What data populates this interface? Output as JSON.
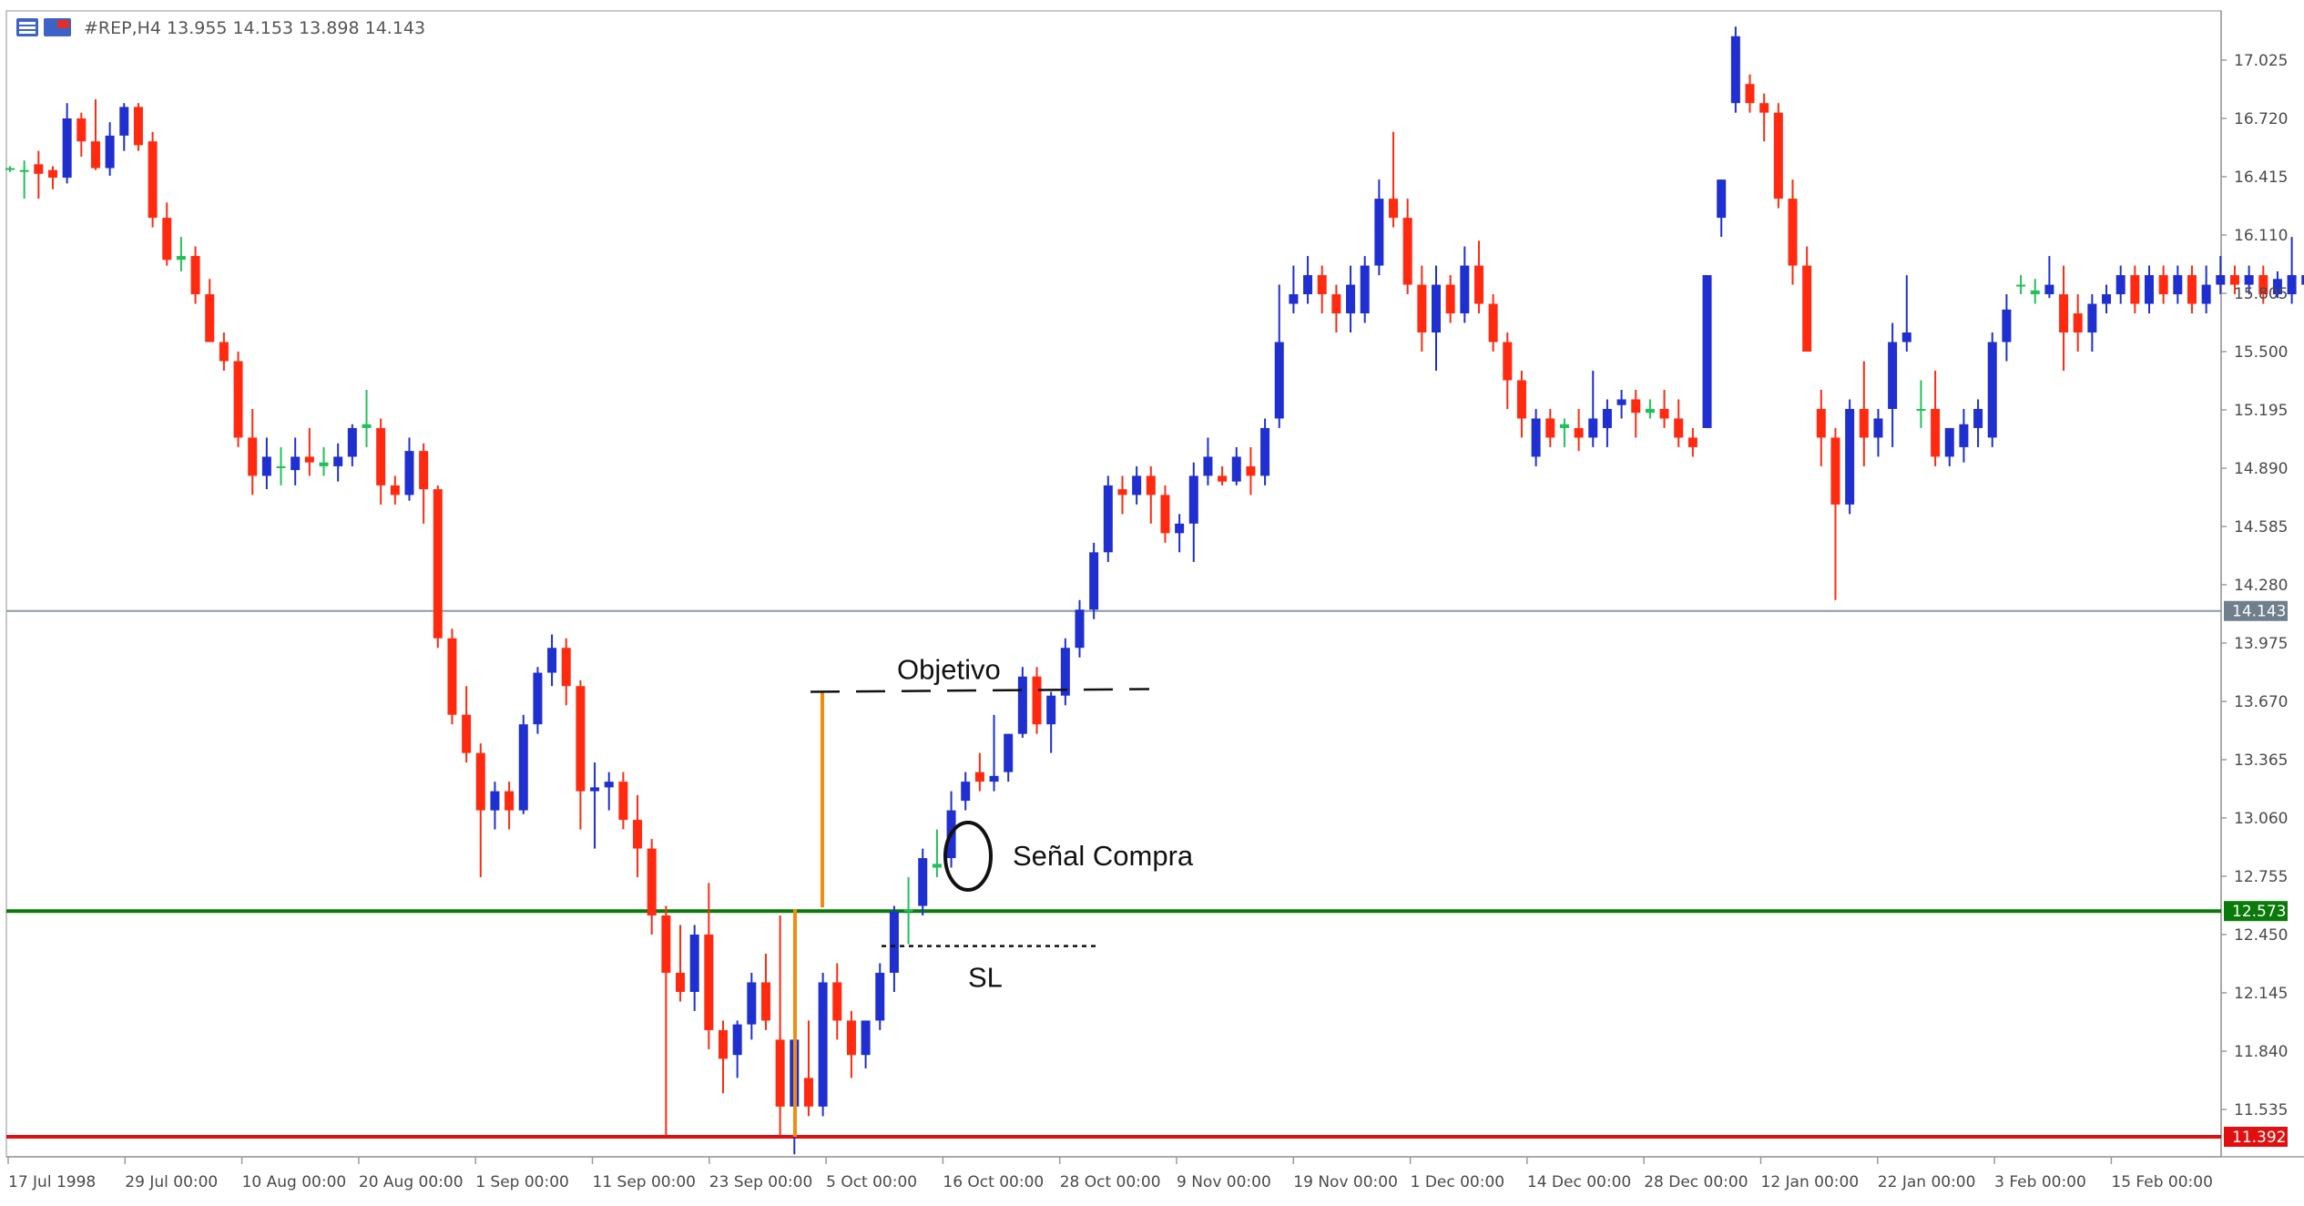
{
  "header": {
    "symbol_line": "#REP,H4  13.955  14.153  13.898  14.143",
    "icons": [
      "menu-icon",
      "window-icon"
    ]
  },
  "colors": {
    "bull": "#1f2fd0",
    "bear": "#ff2a10",
    "doji": "#22c05a",
    "entry_line": "#0a7a0a",
    "stop_line": "#e01010",
    "price_line": "#8a9aa6",
    "target_line": "#f08c10"
  },
  "chart_data": {
    "type": "candlestick",
    "ylim": [
      11.2,
      17.3
    ],
    "y_ticks": [
      "17.025",
      "16.720",
      "16.415",
      "16.110",
      "15.805",
      "15.500",
      "15.195",
      "14.890",
      "14.585",
      "14.280",
      "13.975",
      "13.670",
      "13.365",
      "13.060",
      "12.755",
      "12.450",
      "12.145",
      "11.840",
      "11.535"
    ],
    "x_ticks": [
      "17 Jul 1998",
      "29 Jul 00:00",
      "10 Aug 00:00",
      "20 Aug 00:00",
      "1 Sep 00:00",
      "11 Sep 00:00",
      "23 Sep 00:00",
      "5 Oct 00:00",
      "16 Oct 00:00",
      "28 Oct 00:00",
      "9 Nov 00:00",
      "19 Nov 00:00",
      "1 Dec 00:00",
      "14 Dec 00:00",
      "28 Dec 00:00",
      "12 Jan 00:00",
      "22 Jan 00:00",
      "3 Feb 00:00",
      "15 Feb 00:00"
    ],
    "current_price": "14.143",
    "horizontal_lines": [
      {
        "label": "14.143",
        "value": 14.143,
        "role": "current-price"
      },
      {
        "label": "12.573",
        "value": 12.573,
        "role": "entry"
      },
      {
        "label": "11.392",
        "value": 11.392,
        "role": "stop-low"
      }
    ],
    "annotations": {
      "objetivo": "Objetivo",
      "senal": "Señal Compra",
      "sl": "SL"
    },
    "target_level": 13.72,
    "sl_level": 12.39,
    "candles": [
      [
        16.45,
        16.47,
        16.44,
        16.46
      ],
      [
        16.44,
        16.5,
        16.3,
        16.45
      ],
      [
        16.48,
        16.55,
        16.3,
        16.43
      ],
      [
        16.45,
        16.47,
        16.35,
        16.41
      ],
      [
        16.41,
        16.8,
        16.38,
        16.72
      ],
      [
        16.72,
        16.75,
        16.52,
        16.6
      ],
      [
        16.6,
        16.82,
        16.45,
        16.46
      ],
      [
        16.46,
        16.7,
        16.42,
        16.63
      ],
      [
        16.63,
        16.8,
        16.55,
        16.78
      ],
      [
        16.78,
        16.8,
        16.55,
        16.58
      ],
      [
        16.6,
        16.65,
        16.15,
        16.2
      ],
      [
        16.2,
        16.28,
        15.95,
        15.98
      ],
      [
        15.98,
        16.1,
        15.92,
        16.0
      ],
      [
        16.0,
        16.05,
        15.75,
        15.8
      ],
      [
        15.8,
        15.88,
        15.55,
        15.55
      ],
      [
        15.55,
        15.6,
        15.4,
        15.45
      ],
      [
        15.45,
        15.5,
        15.0,
        15.05
      ],
      [
        15.05,
        15.2,
        14.75,
        14.85
      ],
      [
        14.85,
        15.05,
        14.78,
        14.95
      ],
      [
        14.9,
        15.0,
        14.8,
        14.9
      ],
      [
        14.88,
        15.05,
        14.8,
        14.95
      ],
      [
        14.95,
        15.1,
        14.85,
        14.92
      ],
      [
        14.92,
        15.0,
        14.85,
        14.9
      ],
      [
        14.9,
        15.02,
        14.82,
        14.95
      ],
      [
        14.95,
        15.12,
        14.9,
        15.1
      ],
      [
        15.1,
        15.3,
        15.0,
        15.12
      ],
      [
        15.1,
        15.15,
        14.7,
        14.8
      ],
      [
        14.8,
        14.85,
        14.7,
        14.75
      ],
      [
        14.75,
        15.05,
        14.72,
        14.98
      ],
      [
        14.98,
        15.02,
        14.6,
        14.78
      ],
      [
        14.78,
        14.8,
        13.95,
        14.0
      ],
      [
        14.0,
        14.05,
        13.55,
        13.6
      ],
      [
        13.6,
        13.75,
        13.35,
        13.4
      ],
      [
        13.4,
        13.45,
        12.75,
        13.1
      ],
      [
        13.1,
        13.25,
        13.0,
        13.2
      ],
      [
        13.2,
        13.25,
        13.0,
        13.1
      ],
      [
        13.1,
        13.6,
        13.08,
        13.55
      ],
      [
        13.55,
        13.85,
        13.5,
        13.82
      ],
      [
        13.82,
        14.02,
        13.75,
        13.95
      ],
      [
        13.95,
        14.0,
        13.65,
        13.75
      ],
      [
        13.75,
        13.78,
        13.0,
        13.2
      ],
      [
        13.2,
        13.35,
        12.9,
        13.22
      ],
      [
        13.22,
        13.3,
        13.1,
        13.25
      ],
      [
        13.25,
        13.3,
        13.0,
        13.05
      ],
      [
        13.05,
        13.18,
        12.75,
        12.9
      ],
      [
        12.9,
        12.95,
        12.45,
        12.55
      ],
      [
        12.55,
        12.6,
        11.4,
        12.25
      ],
      [
        12.25,
        12.5,
        12.1,
        12.15
      ],
      [
        12.15,
        12.5,
        12.05,
        12.45
      ],
      [
        12.45,
        12.72,
        11.85,
        11.95
      ],
      [
        11.95,
        12.0,
        11.62,
        11.8
      ],
      [
        11.82,
        12.0,
        11.7,
        11.98
      ],
      [
        11.98,
        12.25,
        11.9,
        12.2
      ],
      [
        12.2,
        12.35,
        11.95,
        12.0
      ],
      [
        11.9,
        12.55,
        11.4,
        11.55
      ],
      [
        11.55,
        12.05,
        11.3,
        11.9
      ],
      [
        11.7,
        12.0,
        11.5,
        11.55
      ],
      [
        11.55,
        12.25,
        11.5,
        12.2
      ],
      [
        12.2,
        12.3,
        11.9,
        12.0
      ],
      [
        12.0,
        12.05,
        11.7,
        11.82
      ],
      [
        11.82,
        12.0,
        11.75,
        12.0
      ],
      [
        12.0,
        12.3,
        11.95,
        12.25
      ],
      [
        12.25,
        12.6,
        12.15,
        12.57
      ],
      [
        12.57,
        12.75,
        12.4,
        12.58
      ],
      [
        12.6,
        12.9,
        12.55,
        12.85
      ],
      [
        12.8,
        13.0,
        12.75,
        12.82
      ],
      [
        12.85,
        13.2,
        12.8,
        13.1
      ],
      [
        13.15,
        13.3,
        13.1,
        13.25
      ],
      [
        13.3,
        13.4,
        13.2,
        13.25
      ],
      [
        13.25,
        13.6,
        13.2,
        13.28
      ],
      [
        13.3,
        13.5,
        13.25,
        13.5
      ],
      [
        13.5,
        13.85,
        13.48,
        13.8
      ],
      [
        13.8,
        13.85,
        13.5,
        13.55
      ],
      [
        13.55,
        13.72,
        13.4,
        13.7
      ],
      [
        13.7,
        14.0,
        13.65,
        13.95
      ],
      [
        13.95,
        14.2,
        13.9,
        14.15
      ],
      [
        14.15,
        14.5,
        14.1,
        14.45
      ],
      [
        14.45,
        14.85,
        14.4,
        14.8
      ],
      [
        14.78,
        14.85,
        14.65,
        14.75
      ],
      [
        14.75,
        14.9,
        14.7,
        14.85
      ],
      [
        14.85,
        14.9,
        14.6,
        14.75
      ],
      [
        14.75,
        14.8,
        14.5,
        14.55
      ],
      [
        14.55,
        14.65,
        14.45,
        14.6
      ],
      [
        14.6,
        14.92,
        14.4,
        14.85
      ],
      [
        14.85,
        15.05,
        14.8,
        14.95
      ],
      [
        14.85,
        14.9,
        14.8,
        14.82
      ],
      [
        14.82,
        15.0,
        14.8,
        14.95
      ],
      [
        14.9,
        15.0,
        14.75,
        14.85
      ],
      [
        14.85,
        15.15,
        14.8,
        15.1
      ],
      [
        15.15,
        15.85,
        15.1,
        15.55
      ],
      [
        15.75,
        15.95,
        15.7,
        15.8
      ],
      [
        15.8,
        16.0,
        15.75,
        15.9
      ],
      [
        15.9,
        15.95,
        15.7,
        15.8
      ],
      [
        15.8,
        15.85,
        15.6,
        15.7
      ],
      [
        15.7,
        15.95,
        15.6,
        15.85
      ],
      [
        15.7,
        16.0,
        15.65,
        15.95
      ],
      [
        15.95,
        16.4,
        15.9,
        16.3
      ],
      [
        16.3,
        16.65,
        16.15,
        16.2
      ],
      [
        16.2,
        16.3,
        15.8,
        15.85
      ],
      [
        15.85,
        15.95,
        15.5,
        15.6
      ],
      [
        15.6,
        15.95,
        15.4,
        15.85
      ],
      [
        15.85,
        15.9,
        15.65,
        15.7
      ],
      [
        15.7,
        16.05,
        15.65,
        15.95
      ],
      [
        15.95,
        16.08,
        15.7,
        15.75
      ],
      [
        15.75,
        15.8,
        15.5,
        15.55
      ],
      [
        15.55,
        15.6,
        15.2,
        15.35
      ],
      [
        15.35,
        15.4,
        15.05,
        15.15
      ],
      [
        14.95,
        15.2,
        14.9,
        15.15
      ],
      [
        15.15,
        15.2,
        15.0,
        15.05
      ],
      [
        15.1,
        15.15,
        15.0,
        15.12
      ],
      [
        15.1,
        15.2,
        14.98,
        15.05
      ],
      [
        15.05,
        15.4,
        15.0,
        15.15
      ],
      [
        15.1,
        15.25,
        15.0,
        15.2
      ],
      [
        15.22,
        15.3,
        15.15,
        15.25
      ],
      [
        15.25,
        15.3,
        15.05,
        15.18
      ],
      [
        15.18,
        15.25,
        15.15,
        15.2
      ],
      [
        15.2,
        15.3,
        15.1,
        15.15
      ],
      [
        15.15,
        15.25,
        15.0,
        15.05
      ],
      [
        15.05,
        15.1,
        14.95,
        15.0
      ],
      [
        15.1,
        15.9,
        15.1,
        15.9
      ],
      [
        16.2,
        16.4,
        16.1,
        16.4
      ],
      [
        16.8,
        17.2,
        16.75,
        17.15
      ],
      [
        16.9,
        16.95,
        16.75,
        16.8
      ],
      [
        16.8,
        16.85,
        16.6,
        16.75
      ],
      [
        16.75,
        16.8,
        16.25,
        16.3
      ],
      [
        16.3,
        16.4,
        15.85,
        15.95
      ],
      [
        15.95,
        16.05,
        15.5,
        15.5
      ],
      [
        15.2,
        15.3,
        14.9,
        15.05
      ],
      [
        15.05,
        15.1,
        14.2,
        14.7
      ],
      [
        14.7,
        15.25,
        14.65,
        15.2
      ],
      [
        15.2,
        15.45,
        14.9,
        15.05
      ],
      [
        15.05,
        15.2,
        14.95,
        15.15
      ],
      [
        15.2,
        15.65,
        15.0,
        15.55
      ],
      [
        15.55,
        15.9,
        15.5,
        15.6
      ],
      [
        15.2,
        15.35,
        15.1,
        15.2
      ],
      [
        15.2,
        15.4,
        14.9,
        14.95
      ],
      [
        14.95,
        15.1,
        14.9,
        15.1
      ],
      [
        15.0,
        15.2,
        14.92,
        15.12
      ],
      [
        15.1,
        15.25,
        15.0,
        15.2
      ],
      [
        15.05,
        15.6,
        15.0,
        15.55
      ],
      [
        15.55,
        15.8,
        15.45,
        15.72
      ],
      [
        15.85,
        15.9,
        15.8,
        15.85
      ],
      [
        15.82,
        15.88,
        15.75,
        15.8
      ],
      [
        15.8,
        16.0,
        15.78,
        15.85
      ],
      [
        15.8,
        15.95,
        15.4,
        15.6
      ],
      [
        15.7,
        15.8,
        15.5,
        15.6
      ],
      [
        15.6,
        15.8,
        15.5,
        15.75
      ],
      [
        15.75,
        15.85,
        15.7,
        15.8
      ],
      [
        15.8,
        15.95,
        15.75,
        15.9
      ],
      [
        15.9,
        15.95,
        15.7,
        15.75
      ],
      [
        15.75,
        15.95,
        15.7,
        15.9
      ],
      [
        15.9,
        15.95,
        15.75,
        15.8
      ],
      [
        15.8,
        15.95,
        15.75,
        15.9
      ],
      [
        15.9,
        15.95,
        15.7,
        15.75
      ],
      [
        15.75,
        15.95,
        15.7,
        15.85
      ],
      [
        15.85,
        16.0,
        15.8,
        15.9
      ],
      [
        15.9,
        15.95,
        15.8,
        15.85
      ],
      [
        15.85,
        15.95,
        15.8,
        15.9
      ],
      [
        15.9,
        15.95,
        15.75,
        15.8
      ],
      [
        15.8,
        15.92,
        15.78,
        15.88
      ],
      [
        15.8,
        16.1,
        15.75,
        15.9
      ],
      [
        15.85,
        15.98,
        15.8,
        15.9
      ],
      [
        15.85,
        16.15,
        15.8,
        15.95
      ]
    ]
  }
}
